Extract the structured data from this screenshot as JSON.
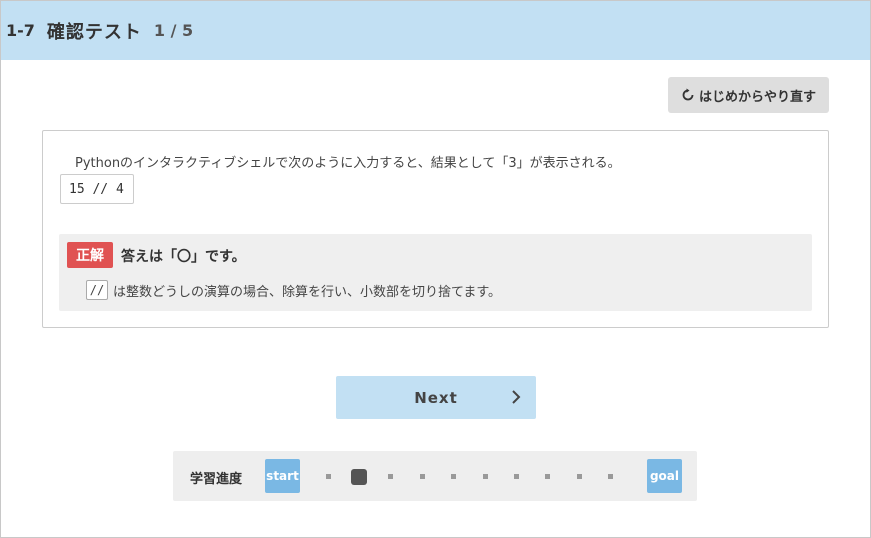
{
  "header": {
    "lesson_number": "1-7",
    "title": "確認テスト",
    "page_indicator": "1 / 5",
    "background_color": "#c2e0f3"
  },
  "toolbar": {
    "restart_label": "はじめからやり直す",
    "restart_icon": "refresh-icon"
  },
  "question": {
    "text": "Pythonのインタラクティブシェルで次のように入力すると、結果として「3」が表示される。",
    "code": "15 // 4"
  },
  "answer": {
    "badge": "正解",
    "badge_color": "#e05252",
    "statement": "答えは「〇」です。",
    "explanation_code": "//",
    "explanation_text": "は整数どうしの演算の場合、除算を行い、小数部を切り捨てます。"
  },
  "navigation": {
    "next_label": "Next",
    "next_icon": "chevron-right-icon"
  },
  "progress": {
    "label": "学習進度",
    "start_label": "start",
    "goal_label": "goal",
    "total_steps": 10,
    "current_step": 2,
    "accent_color": "#7ab8e4"
  }
}
